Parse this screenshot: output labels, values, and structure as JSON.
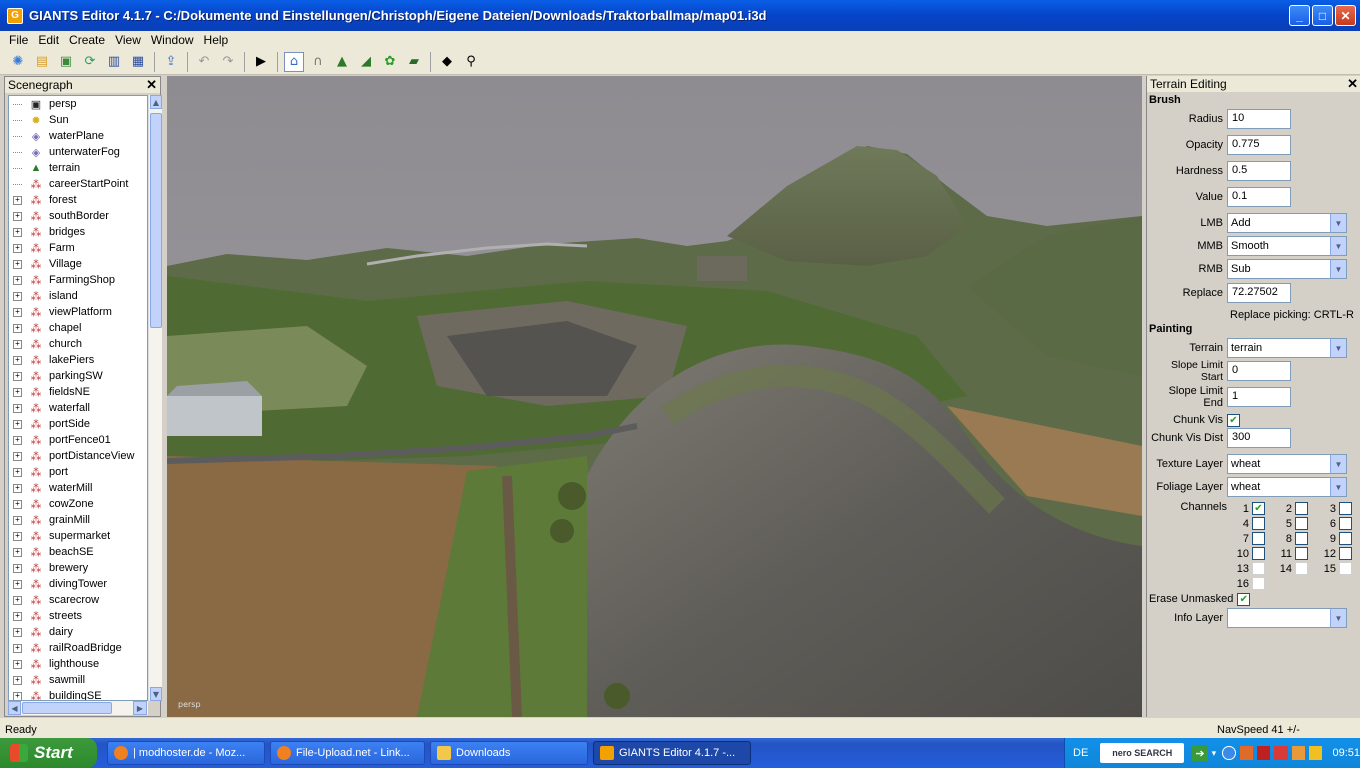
{
  "window": {
    "title": "GIANTS Editor 4.1.7 - C:/Dokumente und Einstellungen/Christoph/Eigene Dateien/Downloads/Traktorballmap/map01.i3d"
  },
  "menu": [
    "File",
    "Edit",
    "Create",
    "View",
    "Window",
    "Help"
  ],
  "scenegraph": {
    "title": "Scenegraph",
    "items": [
      {
        "label": "persp",
        "expandable": false,
        "icon": "camera-icon"
      },
      {
        "label": "Sun",
        "expandable": false,
        "icon": "light-icon"
      },
      {
        "label": "waterPlane",
        "expandable": false,
        "icon": "cube-icon"
      },
      {
        "label": "unterwaterFog",
        "expandable": false,
        "icon": "cube-icon"
      },
      {
        "label": "terrain",
        "expandable": false,
        "icon": "terrain-icon"
      },
      {
        "label": "careerStartPoint",
        "expandable": false,
        "icon": "transform-icon"
      },
      {
        "label": "forest",
        "expandable": true,
        "icon": "transform-icon"
      },
      {
        "label": "southBorder",
        "expandable": true,
        "icon": "transform-icon"
      },
      {
        "label": "bridges",
        "expandable": true,
        "icon": "transform-icon"
      },
      {
        "label": "Farm",
        "expandable": true,
        "icon": "transform-icon"
      },
      {
        "label": "Village",
        "expandable": true,
        "icon": "transform-icon"
      },
      {
        "label": "FarmingShop",
        "expandable": true,
        "icon": "transform-icon"
      },
      {
        "label": "island",
        "expandable": true,
        "icon": "transform-icon"
      },
      {
        "label": "viewPlatform",
        "expandable": true,
        "icon": "transform-icon"
      },
      {
        "label": "chapel",
        "expandable": true,
        "icon": "transform-icon"
      },
      {
        "label": "church",
        "expandable": true,
        "icon": "transform-icon"
      },
      {
        "label": "lakePiers",
        "expandable": true,
        "icon": "transform-icon"
      },
      {
        "label": "parkingSW",
        "expandable": true,
        "icon": "transform-icon"
      },
      {
        "label": "fieldsNE",
        "expandable": true,
        "icon": "transform-icon"
      },
      {
        "label": "waterfall",
        "expandable": true,
        "icon": "transform-icon"
      },
      {
        "label": "portSide",
        "expandable": true,
        "icon": "transform-icon"
      },
      {
        "label": "portFence01",
        "expandable": true,
        "icon": "transform-icon"
      },
      {
        "label": "portDistanceView",
        "expandable": true,
        "icon": "transform-icon"
      },
      {
        "label": "port",
        "expandable": true,
        "icon": "transform-icon"
      },
      {
        "label": "waterMill",
        "expandable": true,
        "icon": "transform-icon"
      },
      {
        "label": "cowZone",
        "expandable": true,
        "icon": "transform-icon"
      },
      {
        "label": "grainMill",
        "expandable": true,
        "icon": "transform-icon"
      },
      {
        "label": "supermarket",
        "expandable": true,
        "icon": "transform-icon"
      },
      {
        "label": "beachSE",
        "expandable": true,
        "icon": "transform-icon"
      },
      {
        "label": "brewery",
        "expandable": true,
        "icon": "transform-icon"
      },
      {
        "label": "divingTower",
        "expandable": true,
        "icon": "transform-icon"
      },
      {
        "label": "scarecrow",
        "expandable": true,
        "icon": "transform-icon"
      },
      {
        "label": "streets",
        "expandable": true,
        "icon": "transform-icon"
      },
      {
        "label": "dairy",
        "expandable": true,
        "icon": "transform-icon"
      },
      {
        "label": "railRoadBridge",
        "expandable": true,
        "icon": "transform-icon"
      },
      {
        "label": "lighthouse",
        "expandable": true,
        "icon": "transform-icon"
      },
      {
        "label": "sawmill",
        "expandable": true,
        "icon": "transform-icon"
      },
      {
        "label": "buildingSE",
        "expandable": true,
        "icon": "transform-icon"
      }
    ]
  },
  "viewport": {
    "camera_label": "persp"
  },
  "terrain_panel": {
    "title": "Terrain Editing",
    "brush_heading": "Brush",
    "radius_label": "Radius",
    "radius": "10",
    "opacity_label": "Opacity",
    "opacity": "0.775",
    "hardness_label": "Hardness",
    "hardness": "0.5",
    "value_label": "Value",
    "value": "0.1",
    "lmb_label": "LMB",
    "lmb": "Add",
    "mmb_label": "MMB",
    "mmb": "Smooth",
    "rmb_label": "RMB",
    "rmb": "Sub",
    "replace_label": "Replace",
    "replace": "72.27502",
    "replace_hint": "Replace picking: CRTL-R",
    "painting_heading": "Painting",
    "terrain_label": "Terrain",
    "terrain": "terrain",
    "slope_start_label": "Slope Limit Start",
    "slope_start": "0",
    "slope_end_label": "Slope Limit End",
    "slope_end": "1",
    "chunk_vis_label": "Chunk Vis",
    "chunk_vis": true,
    "chunk_vis_dist_label": "Chunk Vis Dist",
    "chunk_vis_dist": "300",
    "texture_layer_label": "Texture Layer",
    "texture_layer": "wheat",
    "foliage_layer_label": "Foliage Layer",
    "foliage_layer": "wheat",
    "channels_label": "Channels",
    "channels": [
      {
        "n": "1",
        "checked": true
      },
      {
        "n": "2",
        "checked": false
      },
      {
        "n": "3",
        "checked": false
      },
      {
        "n": "4",
        "checked": false
      },
      {
        "n": "5",
        "checked": false
      },
      {
        "n": "6",
        "checked": false
      },
      {
        "n": "7",
        "checked": false
      },
      {
        "n": "8",
        "checked": false
      },
      {
        "n": "9",
        "checked": false
      },
      {
        "n": "10",
        "checked": false
      },
      {
        "n": "11",
        "checked": false
      },
      {
        "n": "12",
        "checked": false
      },
      {
        "n": "13",
        "checked": false
      },
      {
        "n": "14",
        "checked": false
      },
      {
        "n": "15",
        "checked": false
      },
      {
        "n": "16",
        "checked": false
      }
    ],
    "erase_unmasked_label": "Erase Unmasked",
    "erase_unmasked": true,
    "info_layer_label": "Info Layer",
    "info_layer": ""
  },
  "status": {
    "left": "Ready",
    "right": "NavSpeed 41 +/-"
  },
  "taskbar": {
    "start": "Start",
    "tasks": [
      "| modhoster.de - Moz...",
      "File-Upload.net - Link...",
      "Downloads",
      "GIANTS Editor 4.1.7 -..."
    ],
    "lang": "DE",
    "search_logo": "nero SEARCH",
    "clock": "09:51"
  }
}
